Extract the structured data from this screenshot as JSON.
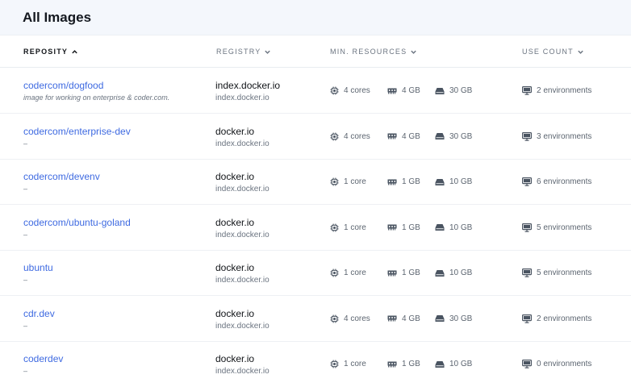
{
  "title": "All Images",
  "columns": {
    "repository": "Reposity",
    "registry": "Registry",
    "resources": "Min. Resources",
    "use_count": "Use Count"
  },
  "colors": {
    "link": "#3e6ae1",
    "muted": "#6b7480",
    "header_bg": "#f4f7fc"
  },
  "rows": [
    {
      "repo": "codercom/dogfood",
      "desc": "image for working on enterprise & coder.com.",
      "registry": "index.docker.io",
      "registry_url": "index.docker.io",
      "cpu": "4 cores",
      "memory": "4 GB",
      "disk": "30 GB",
      "use": "2 environments"
    },
    {
      "repo": "codercom/enterprise-dev",
      "desc": "–",
      "registry": "docker.io",
      "registry_url": "index.docker.io",
      "cpu": "4 cores",
      "memory": "4 GB",
      "disk": "30 GB",
      "use": "3 environments"
    },
    {
      "repo": "codercom/devenv",
      "desc": "–",
      "registry": "docker.io",
      "registry_url": "index.docker.io",
      "cpu": "1 core",
      "memory": "1 GB",
      "disk": "10 GB",
      "use": "6 environments"
    },
    {
      "repo": "codercom/ubuntu-goland",
      "desc": "–",
      "registry": "docker.io",
      "registry_url": "index.docker.io",
      "cpu": "1 core",
      "memory": "1 GB",
      "disk": "10 GB",
      "use": "5 environments"
    },
    {
      "repo": "ubuntu",
      "desc": "–",
      "registry": "docker.io",
      "registry_url": "index.docker.io",
      "cpu": "1 core",
      "memory": "1 GB",
      "disk": "10 GB",
      "use": "5 environments"
    },
    {
      "repo": "cdr.dev",
      "desc": "–",
      "registry": "docker.io",
      "registry_url": "index.docker.io",
      "cpu": "4 cores",
      "memory": "4 GB",
      "disk": "30 GB",
      "use": "2 environments"
    },
    {
      "repo": "coderdev",
      "desc": "–",
      "registry": "docker.io",
      "registry_url": "index.docker.io",
      "cpu": "1 core",
      "memory": "1 GB",
      "disk": "10 GB",
      "use": "0 environments"
    }
  ]
}
